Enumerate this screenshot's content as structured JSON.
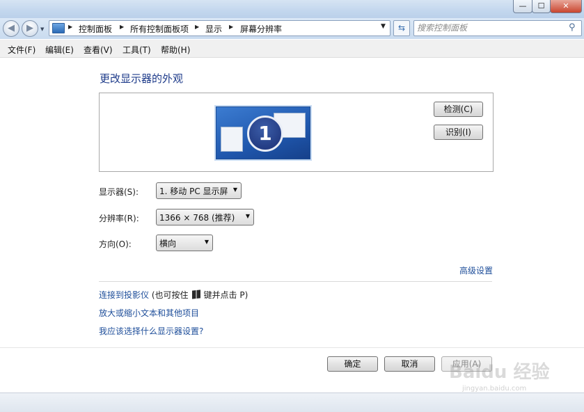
{
  "titlebar": {
    "minimize": "—",
    "maximize": "☐",
    "close": "✕"
  },
  "nav": {
    "back_icon": "back-arrow-icon",
    "forward_icon": "forward-arrow-icon",
    "breadcrumbs": [
      "控制面板",
      "所有控制面板项",
      "显示",
      "屏幕分辨率"
    ],
    "search_placeholder": "搜索控制面板",
    "refresh_icon": "refresh-icon",
    "search_icon": "search-icon"
  },
  "menu": [
    "文件(F)",
    "编辑(E)",
    "查看(V)",
    "工具(T)",
    "帮助(H)"
  ],
  "main": {
    "title": "更改显示器的外观",
    "monitor_number": "1",
    "detect_label": "检测(C)",
    "identify_label": "识别(I)",
    "display_label": "显示器(S):",
    "display_value": "1. 移动 PC 显示屏",
    "resolution_label": "分辨率(R):",
    "resolution_value": "1366 × 768 (推荐)",
    "orientation_label": "方向(O):",
    "orientation_value": "横向",
    "advanced_link": "高级设置",
    "projector_link": "连接到投影仪",
    "projector_prefix": " (也可按住",
    "projector_suffix": "键并点击 P)",
    "zoom_link": "放大或缩小文本和其他项目",
    "help_link": "我应该选择什么显示器设置?"
  },
  "footer": {
    "ok_label": "确定",
    "cancel_label": "取消",
    "apply_label": "应用(A)"
  },
  "watermark": {
    "text": "Baidu 经验",
    "sub": "jingyan.baidu.com"
  },
  "colors": {
    "link": "#1e4e9a",
    "title": "#1e3b8a",
    "glass": "#c3d7ee"
  }
}
